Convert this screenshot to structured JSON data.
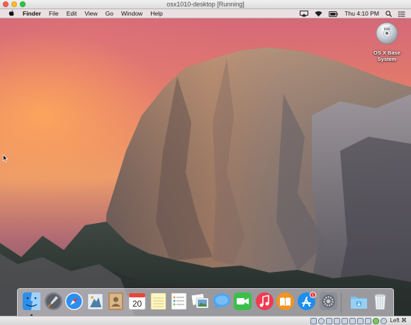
{
  "vm_window": {
    "title": "osx1010-desktop [Running]",
    "host_key_label": "Left ⌘"
  },
  "menubar": {
    "apple_icon": "apple-logo",
    "items": [
      "Finder",
      "File",
      "Edit",
      "View",
      "Go",
      "Window",
      "Help"
    ],
    "clock": "Thu 4:10 PM",
    "status_icons": [
      "airplay-icon",
      "wifi-icon",
      "battery-icon",
      "spotlight-icon",
      "notification-center-icon"
    ]
  },
  "desktop": {
    "icons": [
      {
        "label_line1": "OS X Base",
        "label_line2": "System",
        "icon": "dvd-disc-icon"
      }
    ]
  },
  "dock": {
    "apps": [
      {
        "name": "Finder",
        "icon": "finder-icon",
        "running": true
      },
      {
        "name": "Launchpad",
        "icon": "launchpad-icon"
      },
      {
        "name": "Safari",
        "icon": "safari-icon"
      },
      {
        "name": "Mail",
        "icon": "mail-icon"
      },
      {
        "name": "Contacts",
        "icon": "contacts-icon"
      },
      {
        "name": "Calendar",
        "icon": "calendar-icon",
        "day": "20"
      },
      {
        "name": "Notes",
        "icon": "notes-icon"
      },
      {
        "name": "Reminders",
        "icon": "reminders-icon"
      },
      {
        "name": "Photo Booth",
        "icon": "photos-icon"
      },
      {
        "name": "Messages",
        "icon": "messages-icon"
      },
      {
        "name": "FaceTime",
        "icon": "facetime-icon"
      },
      {
        "name": "iTunes",
        "icon": "itunes-icon"
      },
      {
        "name": "iBooks",
        "icon": "ibooks-icon"
      },
      {
        "name": "App Store",
        "icon": "app-store-icon",
        "badge": "1"
      },
      {
        "name": "System Preferences",
        "icon": "system-preferences-icon"
      },
      {
        "name": "Downloads",
        "icon": "downloads-folder-icon"
      },
      {
        "name": "Trash",
        "icon": "trash-icon"
      }
    ]
  },
  "colors": {
    "accent_red": "#e5352d",
    "menubar_bg": "#ece8ea"
  }
}
